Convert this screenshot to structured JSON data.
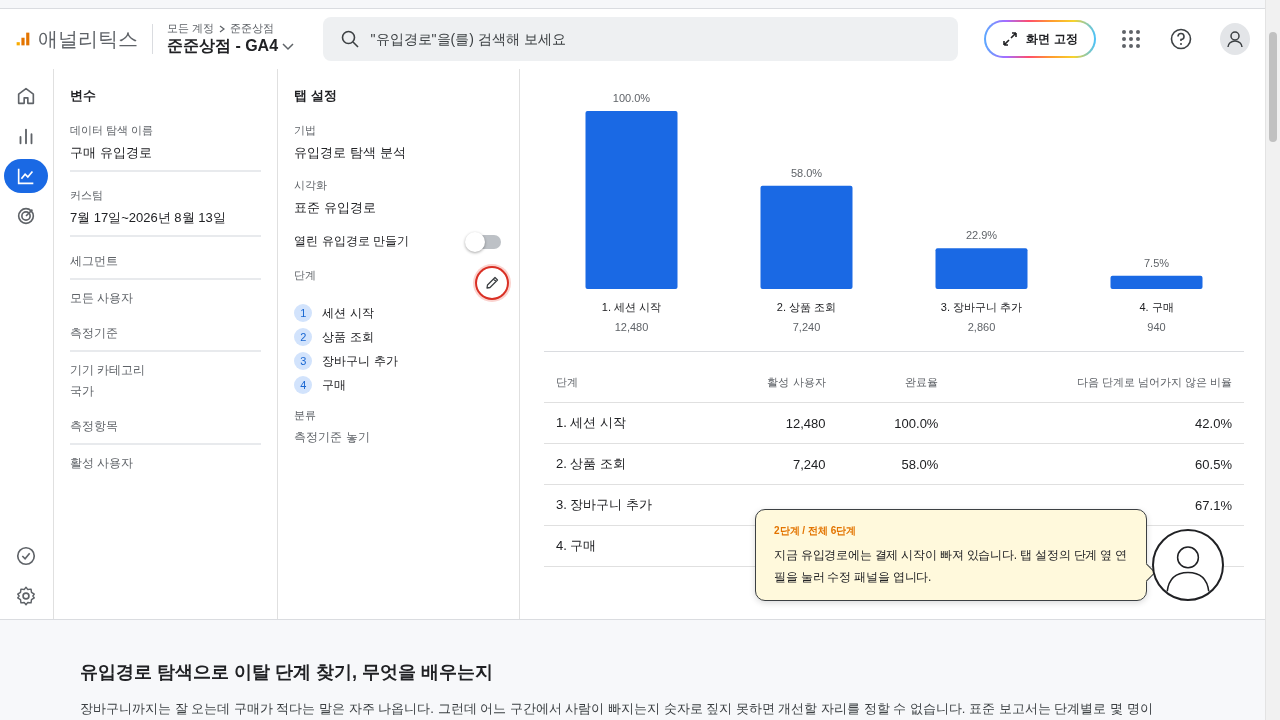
{
  "header": {
    "product": "애널리틱스",
    "breadcrumb": [
      "모든 계정",
      "준준상점"
    ],
    "property": "준준상점 - GA4",
    "search": {
      "placeholder": "\"유입경로\"을(를) 검색해 보세요"
    },
    "pin_button": "화면 고정"
  },
  "rail": {
    "top": [
      {
        "selected": false
      },
      {
        "selected": false
      },
      {
        "selected": true
      },
      {
        "selected": false
      }
    ]
  },
  "variables": {
    "title": "변수",
    "fields": [
      {
        "label": "데이터 탐색 이름",
        "value": "구매 유입경로"
      },
      {
        "label": "커스텀",
        "value": "7월 17일~2026년 8월 13일"
      }
    ],
    "sections": [
      {
        "heading": "세그먼트",
        "items": [
          "모든 사용자"
        ]
      },
      {
        "heading": "측정기준",
        "items": [
          "기기 카테고리",
          "국가"
        ]
      },
      {
        "heading": "측정항목",
        "items": [
          "활성 사용자"
        ]
      }
    ]
  },
  "tab_settings": {
    "title": "탭 설정",
    "fields": [
      {
        "label": "기법",
        "value": "유입경로 탐색 분석"
      },
      {
        "label": "시각화",
        "value": "표준 유입경로"
      }
    ],
    "toggle": {
      "label": "열린 유입경로 만들기",
      "on": false
    },
    "steps": {
      "label": "단계",
      "edit_highlighted": true,
      "items": [
        "세션 시작",
        "상품 조회",
        "장바구니 추가",
        "구매"
      ],
      "numbers": [
        "1",
        "2",
        "3",
        "4"
      ]
    },
    "breakdown": {
      "label": "분류",
      "value": "측정기준 놓기"
    }
  },
  "chart": {
    "chart_data": {
      "type": "bar",
      "categories": [
        "1. 세션 시작",
        "2. 상품 조회",
        "3. 장바구니 추가",
        "4. 구매"
      ],
      "values": [
        100,
        58,
        22.9,
        7.5
      ],
      "value_labels": [
        "100.0%",
        "58.0%",
        "22.9%",
        "7.5%"
      ],
      "annotations": [
        "12,480",
        "7,240",
        "2,860",
        "940"
      ]
    }
  },
  "table": {
    "columns": [
      "단계",
      "활성 사용자",
      "완료율",
      "다음 단계로 넘어가지 않은 비율"
    ],
    "rows": [
      {
        "step": "1. 세션 시작",
        "users": "12,480",
        "rate": "100.0%",
        "drop": "42.0%"
      },
      {
        "step": "2. 상품 조회",
        "users": "7,240",
        "rate": "58.0%",
        "drop": "60.5%"
      },
      {
        "step": "3. 장바구니 추가",
        "drop": "67.1%"
      },
      {
        "step": "4. 구매"
      }
    ]
  },
  "guide": {
    "progress": "2단계 / 전체 6단계",
    "message": "지금 유입경로에는 결제 시작이 빠져 있습니다. 탭 설정의 단계 옆 연필을 눌러 수정 패널을 엽니다."
  },
  "article": {
    "heading": "유입경로 탐색으로 이탈 단계 찾기, 무엇을 배우는지",
    "body": "장바구니까지는 잘 오는데 구매가 적다는 말은 자주 나옵니다. 그런데 어느 구간에서 사람이 빠지는지 숫자로 짚지 못하면 개선할 자리를 정할 수 없습니다. 표준 보고서는 단계별로 몇 명이"
  }
}
